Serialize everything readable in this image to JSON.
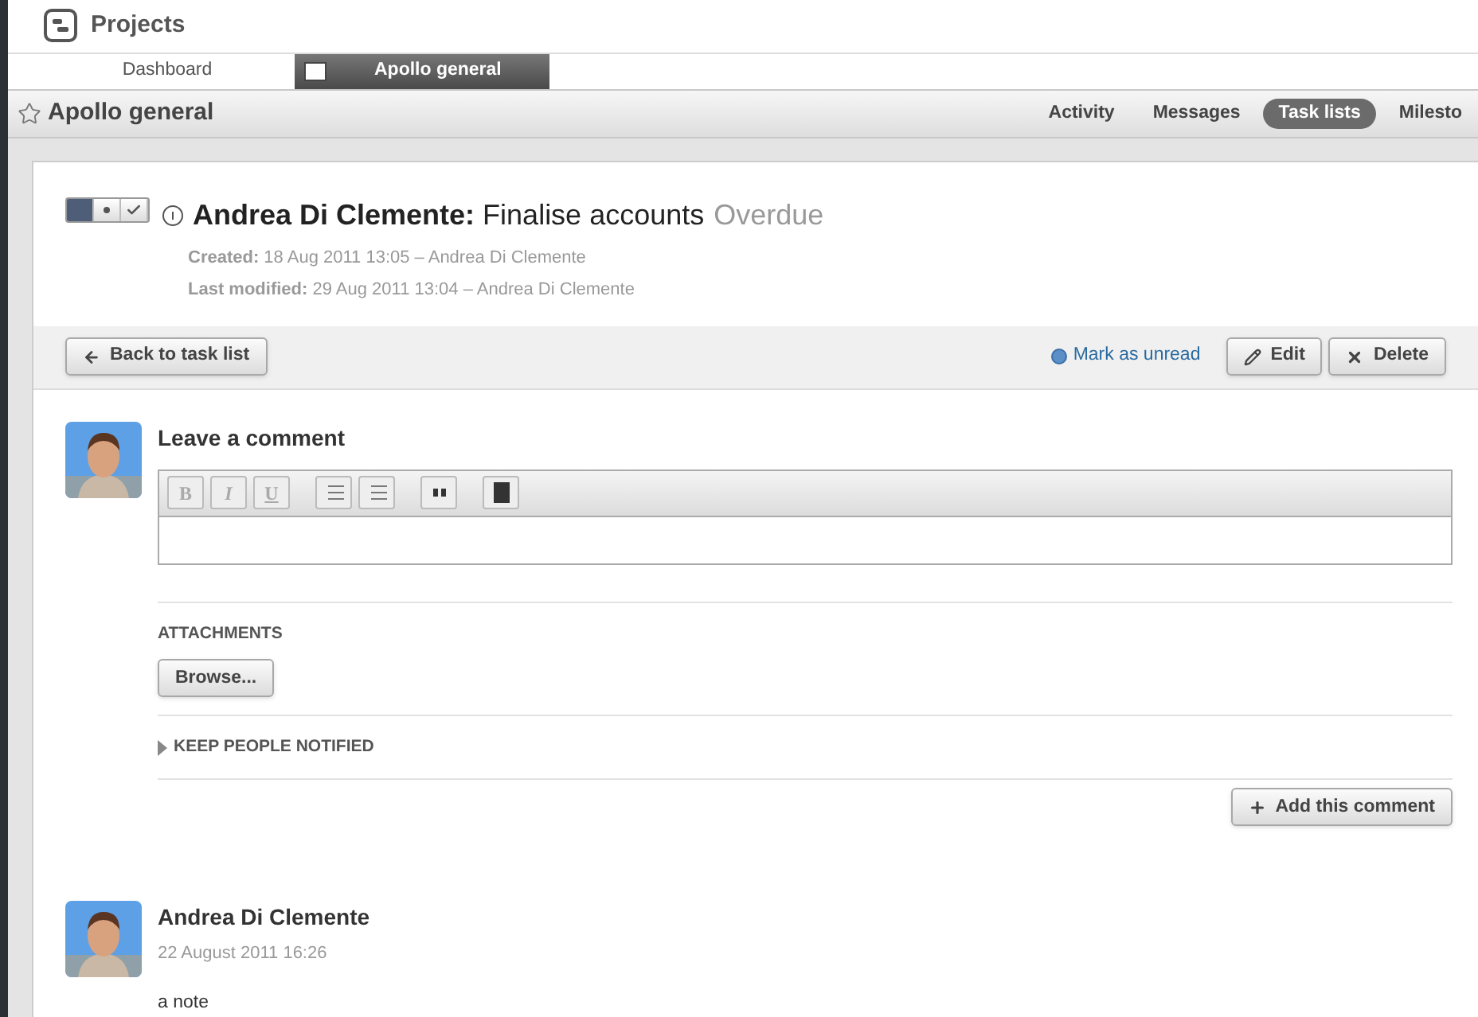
{
  "header": {
    "title": "Projects"
  },
  "tabs": [
    {
      "label": "Dashboard",
      "selected": false
    },
    {
      "label": "Apollo general",
      "selected": true
    }
  ],
  "project": {
    "title": "Apollo general",
    "nav": [
      {
        "label": "Activity",
        "selected": false
      },
      {
        "label": "Messages",
        "selected": false
      },
      {
        "label": "Task lists",
        "selected": true
      },
      {
        "label": "Milesto",
        "selected": false
      }
    ]
  },
  "task": {
    "status_toggle": [
      {
        "selected": true
      },
      {
        "selected": false
      },
      {
        "selected": false
      }
    ],
    "title": "**Andrea Di Clemente:** Finalise accounts",
    "status": "Overdue",
    "meta": [
      "**Created:** 18 Aug 2011 13:05 – Andrea Di Clemente",
      "**Last modified:** 29 Aug 2011 13:04 – Andrea Di Clemente"
    ]
  },
  "actions": {
    "back": "Back to task list",
    "mark_unread": "Mark as unread",
    "edit": "Edit",
    "delete": "Delete"
  },
  "comment_form": {
    "title": "Leave a comment",
    "format_buttons": [
      "B",
      "I",
      "U"
    ],
    "attachments_label": "ATTACHMENTS",
    "browse": "Browse...",
    "notify": {
      "label": "KEEP PEOPLE NOTIFIED",
      "expanded": false
    },
    "submit": "Add this comment"
  },
  "comments": [
    {
      "author": "Andrea Di Clemente",
      "date": "22 August 2011 16:26",
      "text": "a note"
    }
  ]
}
